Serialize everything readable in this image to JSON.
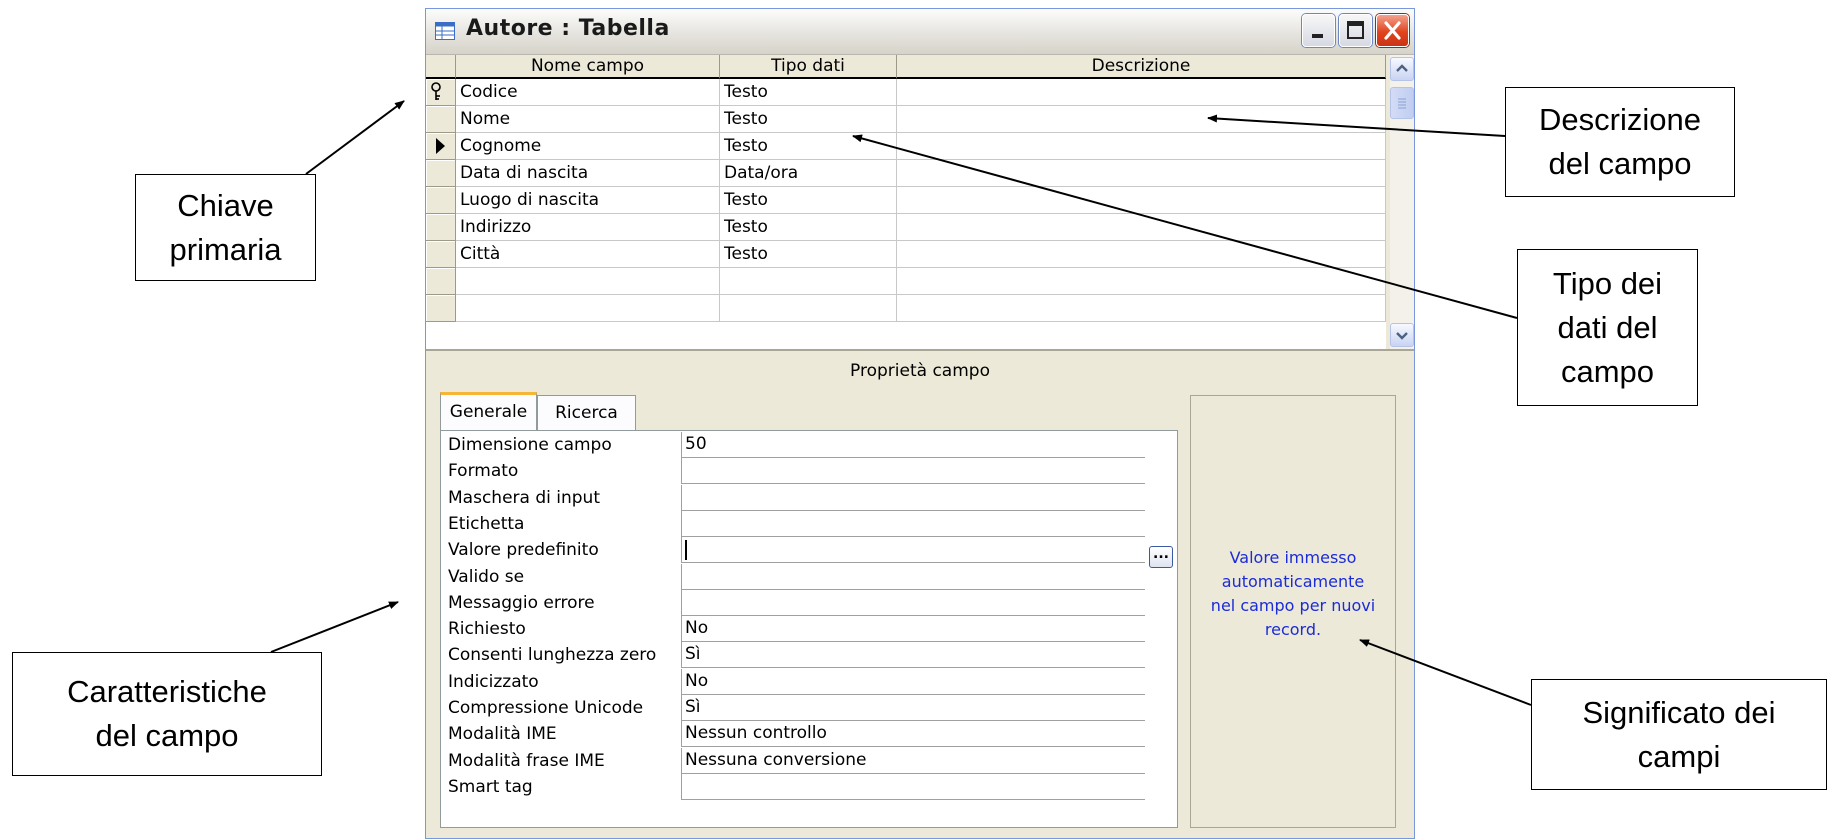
{
  "window": {
    "title": "Autore : Tabella",
    "controls": [
      "minimize-icon",
      "maximize-icon",
      "close-icon"
    ]
  },
  "grid": {
    "headers": [
      "Nome campo",
      "Tipo dati",
      "Descrizione"
    ],
    "rows": [
      {
        "name": "Codice",
        "type": "Testo",
        "description": "",
        "marker": "key-icon"
      },
      {
        "name": "Nome",
        "type": "Testo",
        "description": "",
        "marker": ""
      },
      {
        "name": "Cognome",
        "type": "Testo",
        "description": "",
        "marker": "current-row-icon"
      },
      {
        "name": "Data di nascita",
        "type": "Data/ora",
        "description": "",
        "marker": ""
      },
      {
        "name": "Luogo di nascita",
        "type": "Testo",
        "description": "",
        "marker": ""
      },
      {
        "name": "Indirizzo",
        "type": "Testo",
        "description": "",
        "marker": ""
      },
      {
        "name": "Città",
        "type": "Testo",
        "description": "",
        "marker": ""
      },
      {
        "name": "",
        "type": "",
        "description": "",
        "marker": ""
      },
      {
        "name": "",
        "type": "",
        "description": "",
        "marker": ""
      }
    ]
  },
  "properties": {
    "title": "Proprietà campo",
    "tabs": [
      {
        "label": "Generale",
        "active": true
      },
      {
        "label": "Ricerca",
        "active": false
      }
    ],
    "rows": [
      {
        "label": "Dimensione campo",
        "value": "50"
      },
      {
        "label": "Formato",
        "value": ""
      },
      {
        "label": "Maschera di input",
        "value": ""
      },
      {
        "label": "Etichetta",
        "value": ""
      },
      {
        "label": "Valore predefinito",
        "value": ""
      },
      {
        "label": "Valido se",
        "value": ""
      },
      {
        "label": "Messaggio errore",
        "value": ""
      },
      {
        "label": "Richiesto",
        "value": "No"
      },
      {
        "label": "Consenti lunghezza zero",
        "value": "Sì"
      },
      {
        "label": "Indicizzato",
        "value": "No"
      },
      {
        "label": "Compressione Unicode",
        "value": "Sì"
      },
      {
        "label": "Modalità IME",
        "value": "Nessun controllo"
      },
      {
        "label": "Modalità frase IME",
        "value": "Nessuna conversione"
      },
      {
        "label": "Smart tag",
        "value": ""
      }
    ],
    "builder_button": "...",
    "help_text": "Valore immesso\nautomaticamente\nnel campo per nuovi\nrecord."
  },
  "annotations": {
    "chiave": "Chiave\nprimaria",
    "caratteristiche": "Caratteristiche\ndel campo",
    "descrizione": "Descrizione\ndel campo",
    "tipo": "Tipo dei\ndati del\ncampo",
    "significato": "Significato dei\ncampi"
  },
  "colors": {
    "help_text": "#1b2bd6",
    "active_tab_accent": "#f7b536",
    "window_face": "#ece9d8",
    "close_button": "#e0451f"
  }
}
